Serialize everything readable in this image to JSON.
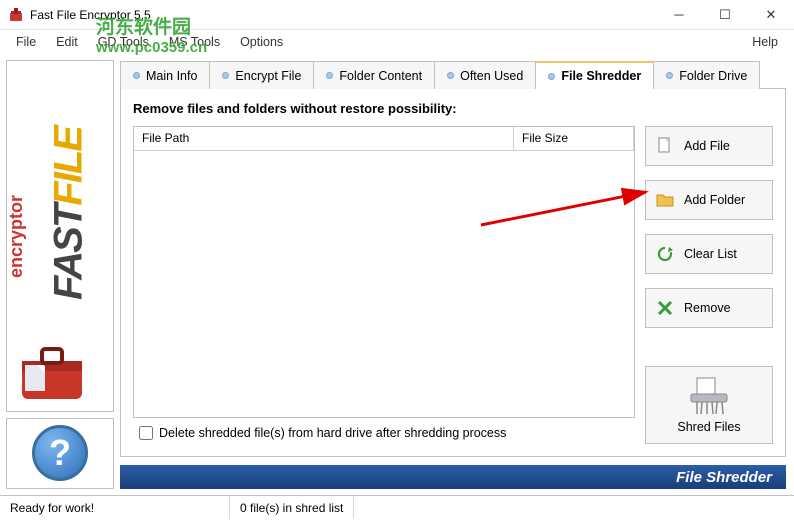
{
  "window": {
    "title": "Fast File Encryptor 5.5"
  },
  "menu": {
    "file": "File",
    "edit": "Edit",
    "gd": "GD Tools",
    "ms": "MS Tools",
    "options": "Options",
    "help": "Help"
  },
  "tabs": {
    "main": "Main Info",
    "encrypt": "Encrypt File",
    "folder": "Folder Content",
    "often": "Often Used",
    "shredder": "File Shredder",
    "drive": "Folder Drive"
  },
  "panel": {
    "heading": "Remove files and folders without restore possibility:",
    "col_path": "File Path",
    "col_size": "File Size",
    "checkbox": "Delete shredded file(s) from hard drive after shredding process"
  },
  "buttons": {
    "add_file": "Add File",
    "add_folder": "Add Folder",
    "clear": "Clear List",
    "remove": "Remove",
    "shred": "Shred Files"
  },
  "footer": "File Shredder",
  "status": {
    "ready": "Ready for work!",
    "count": "0 file(s) in shred list"
  },
  "logo": {
    "fast": "FAST",
    "file": "FILE",
    "enc": "encryptor"
  },
  "watermark": {
    "line1": "河东软件园",
    "line2": "www.pc0359.cn"
  }
}
